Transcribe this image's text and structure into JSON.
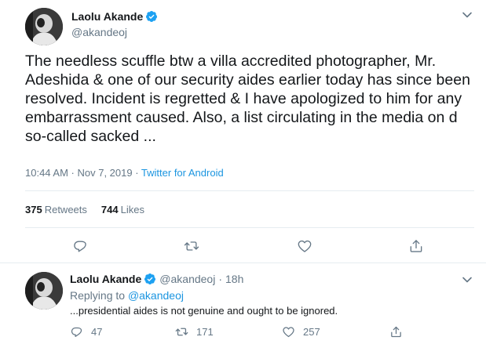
{
  "tweet": {
    "display_name": "Laolu Akande",
    "handle": "@akandeoj",
    "text": "The needless scuffle btw a villa accredited photographer, Mr. Adeshida & one of our security aides earlier today has since been resolved. Incident is regretted & I have apologized to him for any embarrassment caused. Also, a list circulating in the media on d so-called sacked ...",
    "timestamp": "10:44 AM · Nov 7, 2019",
    "separator": " · ",
    "source": "Twitter for Android",
    "retweets_count": "375",
    "retweets_label": "Retweets",
    "likes_count": "744",
    "likes_label": "Likes"
  },
  "reply": {
    "display_name": "Laolu Akande",
    "handle": "@akandeoj",
    "dot": "·",
    "time": "18h",
    "replying_prefix": "Replying to ",
    "replying_to": "@akandeoj",
    "text": "...presidential aides is not genuine and ought to be ignored.",
    "reply_count": "47",
    "retweet_count": "171",
    "like_count": "257"
  },
  "icons": {
    "verified": "verified-badge-icon",
    "caret": "chevron-down-icon",
    "reply": "reply-icon",
    "retweet": "retweet-icon",
    "like": "heart-icon",
    "share": "share-icon"
  },
  "colors": {
    "accent": "#1b95e0",
    "text": "#14171a",
    "muted": "#657786",
    "divider": "#e6ecf0"
  }
}
